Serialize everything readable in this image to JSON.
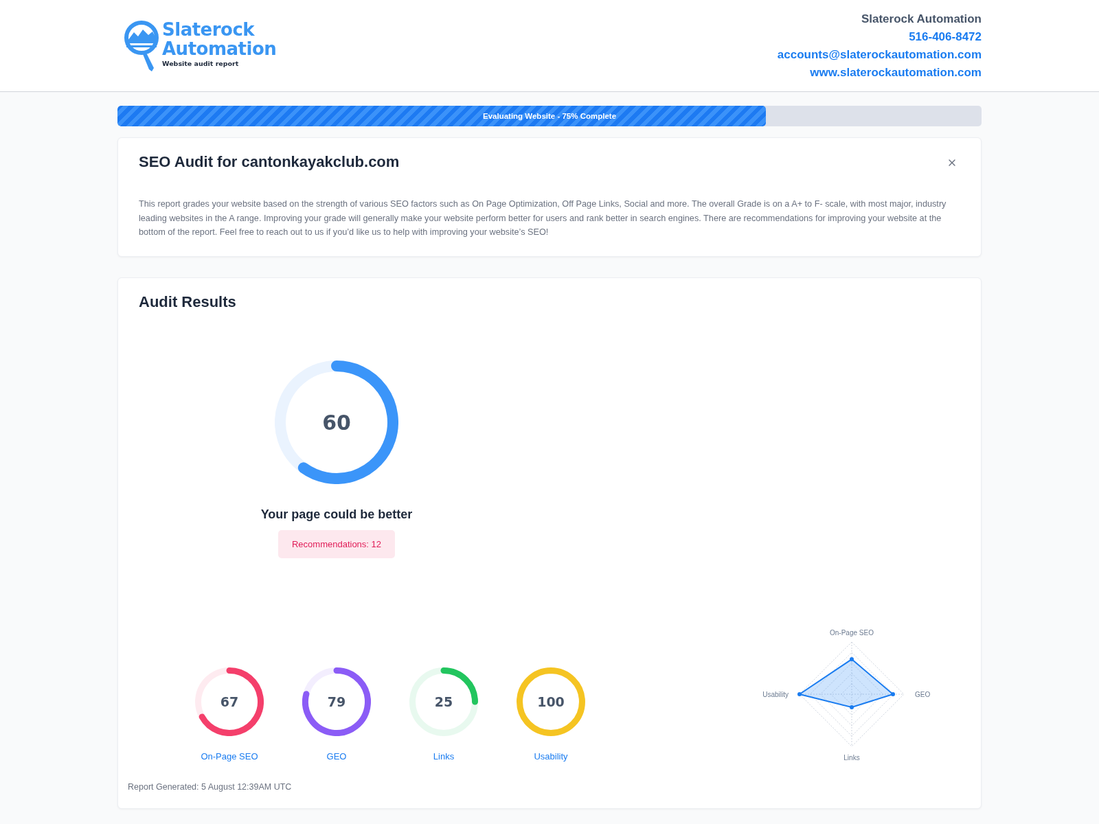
{
  "header": {
    "logo": {
      "line_1": "Slaterock",
      "line_2": "Automation",
      "tagline": "Website audit report"
    },
    "contact": {
      "company": "Slaterock Automation",
      "phone": "516-406-8472",
      "email": "accounts@slaterockautomation.com",
      "website": "www.slaterockautomation.com"
    }
  },
  "progress": {
    "label": "Evaluating Website - 75% Complete",
    "level": 0.75
  },
  "intro_card": {
    "title": "SEO Audit for cantonkayakclub.com",
    "body": "This report grades your website based on the strength of various SEO factors such as On Page Optimization, Off Page Links, Social and more. The overall Grade is on a A+ to F- scale, with most major, industry leading websites in the A range. Improving your grade will generally make your website perform better for users and rank better in search engines. There are recommendations for improving your website at the bottom of the report. Feel free to reach out to us if you’d like us to help with improving your website’s SEO!"
  },
  "audit": {
    "title": "Audit Results",
    "overall": {
      "score": "60",
      "verdict": "Your page could be better",
      "recommendations": "Recommendations: 12"
    },
    "categories": [
      {
        "name": "On-Page SEO",
        "score": "67",
        "color": "#f43f6b"
      },
      {
        "name": "GEO",
        "score": "79",
        "color": "#8b5cf6"
      },
      {
        "name": "Links",
        "score": "25",
        "color": "#22c55e"
      },
      {
        "name": "Usability",
        "score": "100",
        "color": "#f5c422"
      }
    ],
    "radar": {
      "axes": [
        "On-Page SEO",
        "GEO",
        "Links",
        "Usability"
      ]
    },
    "footer": "Report Generated: 5 August 12:39AM UTC"
  }
}
